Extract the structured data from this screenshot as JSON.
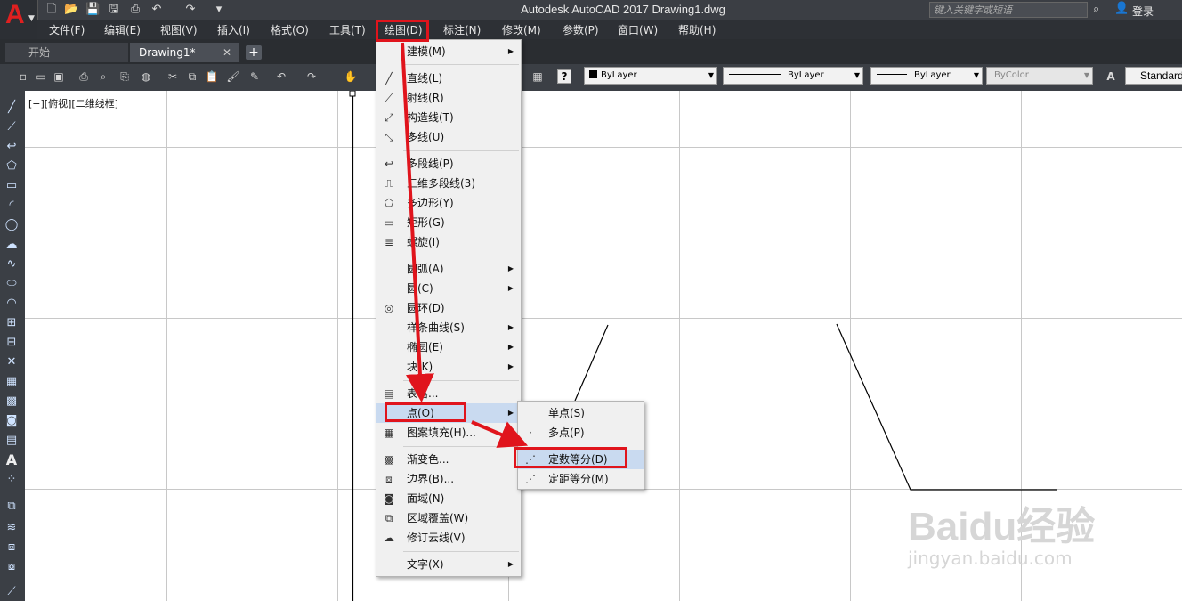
{
  "app": {
    "title": "Autodesk AutoCAD 2017    Drawing1.dwg",
    "search_placeholder": "键入关键字或短语",
    "login": "登录"
  },
  "menubar": [
    "文件(F)",
    "编辑(E)",
    "视图(V)",
    "插入(I)",
    "格式(O)",
    "工具(T)",
    "绘图(D)",
    "标注(N)",
    "修改(M)",
    "参数(P)",
    "窗口(W)",
    "帮助(H)"
  ],
  "tabs": [
    "开始",
    "Drawing1*"
  ],
  "toolbar": {
    "layer": "ByLayer",
    "linetype": "ByLayer",
    "lineweight": "ByLayer",
    "color": "ByColor",
    "textstyle": "Standard"
  },
  "viewport_label": "[−][俯视][二维线框]",
  "draw_menu": {
    "items": [
      "建模(M)",
      "直线(L)",
      "射线(R)",
      "构造线(T)",
      "多线(U)",
      "多段线(P)",
      "三维多段线(3)",
      "多边形(Y)",
      "矩形(G)",
      "螺旋(I)",
      "圆弧(A)",
      "圆(C)",
      "圆环(D)",
      "样条曲线(S)",
      "椭圆(E)",
      "块(K)",
      "表格...",
      "点(O)",
      "图案填充(H)...",
      "渐变色...",
      "边界(B)...",
      "面域(N)",
      "区域覆盖(W)",
      "修订云线(V)",
      "文字(X)"
    ]
  },
  "point_submenu": {
    "items": [
      "单点(S)",
      "多点(P)",
      "定数等分(D)",
      "定距等分(M)"
    ]
  },
  "watermark": {
    "brand": "Baidu经验",
    "url": "jingyan.baidu.com"
  }
}
